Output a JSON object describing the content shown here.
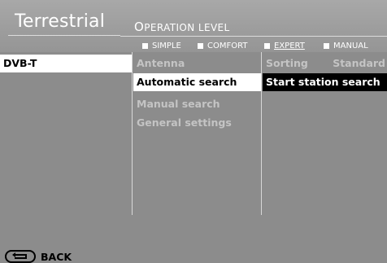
{
  "header": {
    "title": "Terrestrial",
    "operation_level_first": "O",
    "operation_level_rest": "PERATION LEVEL",
    "modes": [
      {
        "label": "SIMPLE",
        "active": false
      },
      {
        "label": "COMFORT",
        "active": false
      },
      {
        "label": "EXPERT",
        "active": true
      },
      {
        "label": "MANUAL",
        "active": false
      }
    ]
  },
  "column1": {
    "items": [
      "DVB-T"
    ]
  },
  "column2": {
    "items": [
      "Antenna",
      "Automatic search",
      "Manual search",
      "General settings"
    ]
  },
  "column3": {
    "sorting_label": "Sorting",
    "sorting_value": "Standard",
    "start_label": "Start station search"
  },
  "footer": {
    "back_label": "BACK"
  },
  "colors": {
    "background": "#8c8c8c",
    "selected_white": "#ffffff",
    "selected_black": "#000000",
    "disabled_text": "#c4c4c4"
  }
}
